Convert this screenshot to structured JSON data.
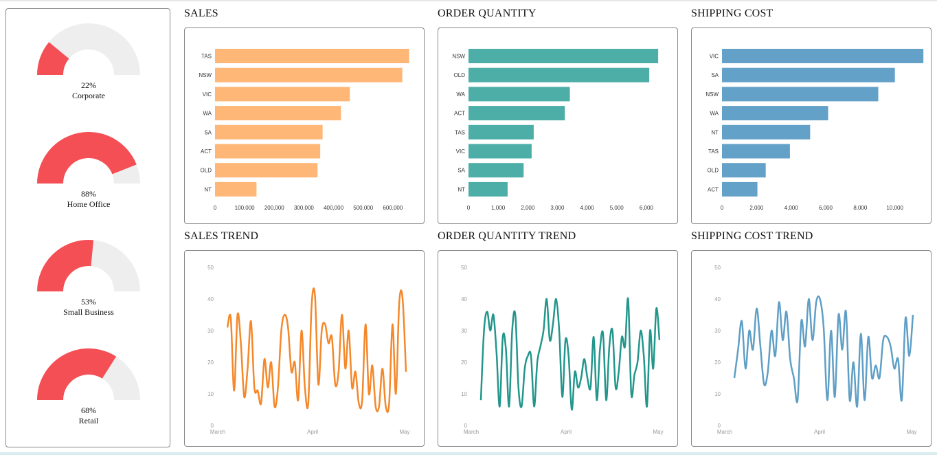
{
  "colors": {
    "gauge_fill": "#f44f55",
    "gauge_track": "#eeeeee",
    "sales": "#ffb778",
    "orders": "#4dada7",
    "shipping": "#64a1c9",
    "sales_trend": "#f4882a",
    "orders_trend": "#23968c",
    "shipping_trend": "#5f9fc6"
  },
  "segments": [
    {
      "percent_label": "22%",
      "label": "Corporate",
      "value": 0.22
    },
    {
      "percent_label": "88%",
      "label": "Home Office",
      "value": 0.88
    },
    {
      "percent_label": "53%",
      "label": "Small Business",
      "value": 0.53
    },
    {
      "percent_label": "68%",
      "label": "Retail",
      "value": 0.68
    }
  ],
  "panels": {
    "sales": {
      "title": "SALES"
    },
    "orders": {
      "title": "ORDER QUANTITY"
    },
    "shipping": {
      "title": "SHIPPING COST"
    },
    "sales_trend": {
      "title": "SALES TREND"
    },
    "orders_trend": {
      "title": "ORDER QUANTITY TREND"
    },
    "shipping_trend": {
      "title": "SHIPPING COST TREND"
    }
  },
  "chart_data": [
    {
      "id": "sales",
      "type": "bar",
      "orientation": "horizontal",
      "title": "SALES",
      "categories": [
        "TAS",
        "NSW",
        "VIC",
        "WA",
        "SA",
        "ACT",
        "OLD",
        "NT"
      ],
      "values": [
        655000,
        632000,
        455000,
        425000,
        363000,
        355000,
        346000,
        140000
      ],
      "xlim": [
        0,
        700000
      ],
      "ticks": [
        0,
        100000,
        200000,
        300000,
        400000,
        500000,
        600000
      ],
      "tick_labels": [
        "0",
        "100,000",
        "200,000",
        "300,000",
        "400,000",
        "500,000",
        "600,000"
      ]
    },
    {
      "id": "orders",
      "type": "bar",
      "orientation": "horizontal",
      "title": "ORDER QUANTITY",
      "categories": [
        "NSW",
        "OLD",
        "WA",
        "ACT",
        "TAS",
        "VIC",
        "SA",
        "NT"
      ],
      "values": [
        6400,
        6100,
        3420,
        3250,
        2200,
        2130,
        1860,
        1320
      ],
      "xlim": [
        0,
        7000
      ],
      "ticks": [
        0,
        1000,
        2000,
        3000,
        4000,
        5000,
        6000
      ],
      "tick_labels": [
        "0",
        "1,000",
        "2,000",
        "3,000",
        "4,000",
        "5,000",
        "6,000"
      ]
    },
    {
      "id": "shipping",
      "type": "bar",
      "orientation": "horizontal",
      "title": "SHIPPING COST",
      "categories": [
        "VIC",
        "SA",
        "NSW",
        "WA",
        "NT",
        "TAS",
        "OLD",
        "ACT"
      ],
      "values": [
        11650,
        10000,
        9040,
        6140,
        5100,
        3930,
        2530,
        2050
      ],
      "xlim": [
        0,
        12000
      ],
      "ticks": [
        0,
        2000,
        4000,
        6000,
        8000,
        10000
      ],
      "tick_labels": [
        "0",
        "2,000",
        "4,000",
        "6,000",
        "8,000",
        "10,000"
      ]
    },
    {
      "id": "sales_trend",
      "type": "line",
      "title": "SALES TREND",
      "ylim": [
        0,
        50
      ],
      "yticks": [
        "0",
        "10",
        "20",
        "30",
        "40",
        "50"
      ],
      "xticks": [
        "March",
        "April",
        "May"
      ],
      "values": [
        31,
        34,
        11,
        35,
        26,
        9,
        18,
        33,
        12,
        11,
        7,
        21,
        12,
        20,
        6,
        12,
        30,
        35,
        31,
        17,
        20,
        8,
        30,
        12,
        7,
        38,
        41,
        13,
        30,
        32,
        26,
        28,
        13,
        17,
        35,
        18,
        30,
        12,
        17,
        7,
        8,
        32,
        10,
        19,
        6,
        6,
        18,
        6,
        7,
        32,
        10,
        39,
        40,
        17
      ]
    },
    {
      "id": "orders_trend",
      "type": "line",
      "title": "ORDER QUANTITY TREND",
      "ylim": [
        0,
        50
      ],
      "yticks": [
        "0",
        "10",
        "20",
        "30",
        "40",
        "50"
      ],
      "xticks": [
        "March",
        "April",
        "May"
      ],
      "values": [
        8,
        30,
        36,
        30,
        35,
        23,
        6,
        28,
        24,
        6,
        30,
        35,
        12,
        6,
        18,
        22,
        22,
        6,
        20,
        25,
        30,
        40,
        27,
        32,
        40,
        30,
        9,
        27,
        22,
        5,
        17,
        12,
        15,
        21,
        15,
        12,
        28,
        8,
        24,
        29,
        8,
        25,
        30,
        12,
        17,
        28,
        25,
        40,
        10,
        16,
        20,
        30,
        22,
        6,
        30,
        18,
        37,
        27
      ]
    },
    {
      "id": "shipping_trend",
      "type": "line",
      "title": "SHIPPING COST TREND",
      "ylim": [
        0,
        50
      ],
      "yticks": [
        "0",
        "10",
        "20",
        "30",
        "40",
        "50"
      ],
      "xticks": [
        "March",
        "April",
        "May"
      ],
      "values": [
        15,
        24,
        33,
        18,
        30,
        24,
        37,
        25,
        13,
        17,
        30,
        22,
        39,
        27,
        36,
        21,
        15,
        8,
        33,
        25,
        40,
        27,
        39,
        40,
        31,
        8,
        30,
        9,
        35,
        24,
        36,
        8,
        20,
        6,
        29,
        8,
        28,
        15,
        19,
        15,
        27,
        28,
        25,
        18,
        21,
        8,
        34,
        22,
        35
      ]
    }
  ]
}
